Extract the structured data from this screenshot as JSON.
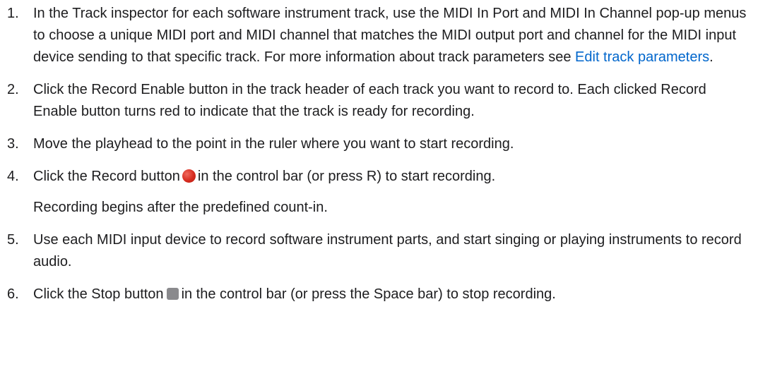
{
  "steps": [
    {
      "number": "1.",
      "text_before": "In the Track inspector for each software instrument track, use the MIDI In Port and MIDI In Channel pop-up menus to choose a unique MIDI port and MIDI channel that matches the MIDI output port and channel for the MIDI input device sending to that specific track. For more information about track parameters see ",
      "link": "Edit track parameters",
      "text_after": "."
    },
    {
      "number": "2.",
      "text": "Click the Record Enable button in the track header of each track you want to record to. Each clicked Record Enable button turns red to indicate that the track is ready for recording."
    },
    {
      "number": "3.",
      "text": "Move the playhead to the point in the ruler where you want to start recording."
    },
    {
      "number": "4.",
      "text_before": "Click the Record button",
      "icon": "record-icon",
      "text_after": "in the control bar (or press R) to start recording.",
      "note": "Recording begins after the predefined count-in."
    },
    {
      "number": "5.",
      "text": "Use each MIDI input device to record software instrument parts, and start singing or playing instruments to record audio."
    },
    {
      "number": "6.",
      "text_before": "Click the Stop button",
      "icon": "stop-icon",
      "text_after": "in the control bar (or press the Space bar) to stop recording."
    }
  ],
  "colors": {
    "text": "#1d1d1f",
    "link": "#0066cc",
    "record_icon": "#d62b1f",
    "stop_icon": "#8a8a8d"
  }
}
